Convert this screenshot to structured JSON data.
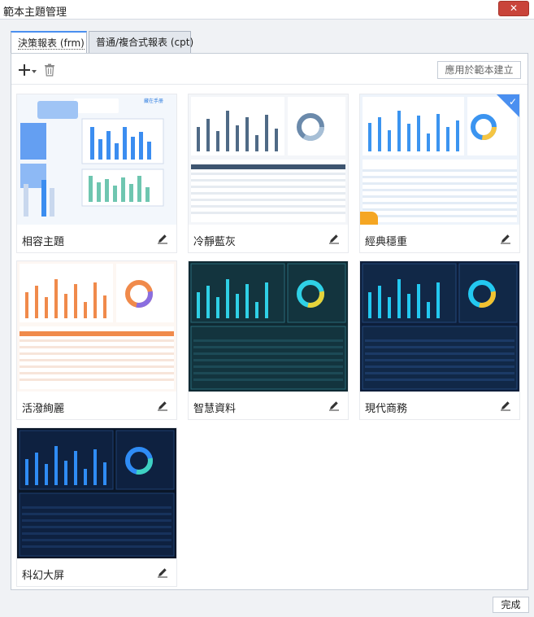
{
  "window": {
    "title": "範本主題管理",
    "close_glyph": "✕"
  },
  "tabs": [
    {
      "label": "決策報表 (frm)",
      "active": true
    },
    {
      "label": "普通/複合式報表 (cpt)",
      "active": false
    }
  ],
  "toolbar": {
    "add_icon": "plus-icon",
    "delete_icon": "trash-icon",
    "apply_label": "應用於範本建立"
  },
  "themes": [
    {
      "name": "相容主題",
      "style": "light-illustration"
    },
    {
      "name": "冷靜藍灰",
      "style": "blue-gray"
    },
    {
      "name": "經典穩重",
      "style": "light-blue",
      "selected": true
    },
    {
      "name": "活潑絢麗",
      "style": "orange"
    },
    {
      "name": "智慧資料",
      "style": "dark-teal"
    },
    {
      "name": "現代商務",
      "style": "dark-navy"
    },
    {
      "name": "科幻大屏",
      "style": "dark-scifi"
    }
  ],
  "thumbnail_brand": "藏在手册",
  "selected_check": "✓",
  "footer": {
    "done_label": "完成"
  },
  "colors": {
    "accent": "#4a8ff0",
    "close_red": "#c9443a",
    "badge_orange": "#f5a623"
  }
}
